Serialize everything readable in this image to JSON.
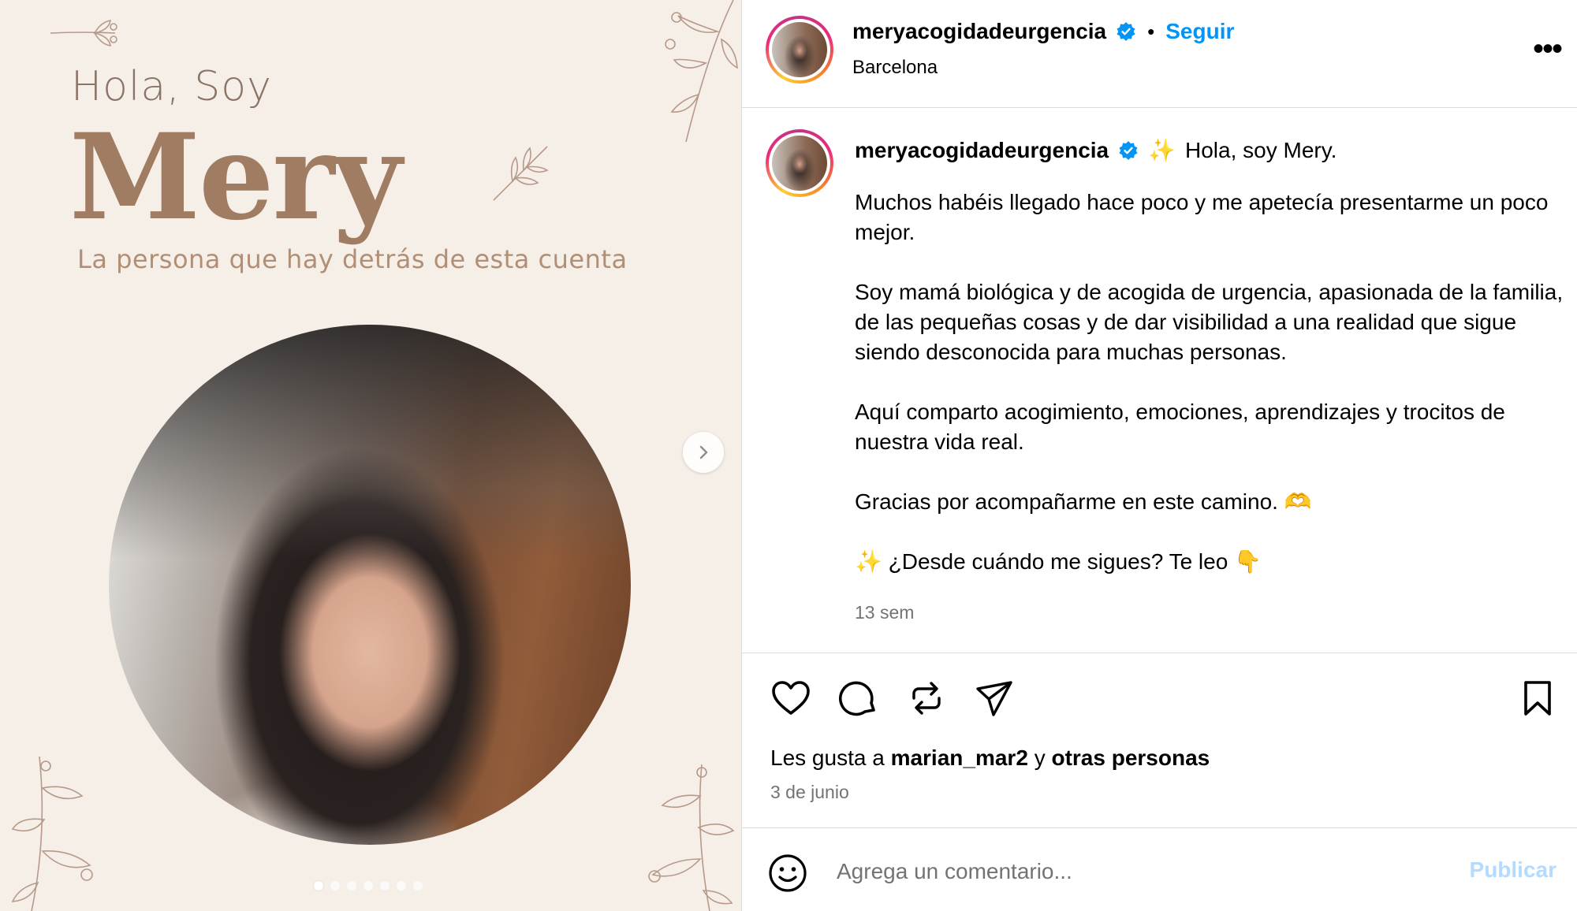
{
  "media": {
    "greeting": "Hola, Soy",
    "name": "Mery",
    "tagline": "La persona que hay detrás de esta cuenta",
    "next_icon": "chevron-right-icon",
    "slide_count": 7,
    "active_slide": 1
  },
  "header": {
    "username": "meryacogidadeurgencia",
    "separator": "•",
    "follow_label": "Seguir",
    "location": "Barcelona",
    "more_icon": "more-horizontal-icon",
    "more_label": "•••"
  },
  "caption": {
    "username": "meryacogidadeurgencia",
    "sparkle": "✨",
    "intro": "Hola, soy Mery.",
    "paragraphs": [
      "Muchos habéis llegado hace poco y me apetecía presentarme un poco mejor.",
      "Soy mamá biológica y de acogida de urgencia, apasionada de la familia, de las pequeñas cosas y de dar visibilidad a una realidad que sigue siendo desconocida para muchas personas.",
      "Aquí comparto acogimiento, emociones, aprendizajes y trocitos de nuestra vida real.",
      "Gracias por acompañarme en este camino. 🫶",
      "✨ ¿Desde cuándo me sigues? Te leo 👇"
    ],
    "time_ago": "13 sem"
  },
  "actions": {
    "like_icon": "heart-icon",
    "comment_icon": "comment-icon",
    "repost_icon": "repost-icon",
    "share_icon": "send-icon",
    "save_icon": "bookmark-icon"
  },
  "likes": {
    "prefix": "Les gusta a",
    "user": "marian_mar2",
    "connector": "y",
    "others": "otras personas"
  },
  "date": "3 de junio",
  "comment": {
    "emoji_icon": "smiley-icon",
    "placeholder": "Agrega un comentario...",
    "value": "",
    "publish_label": "Publicar"
  },
  "colors": {
    "accent": "#0095f6",
    "publish_disabled": "#b3dbff",
    "card_background": "#f6efe7",
    "title_brown": "#a07c63",
    "verified": "#0095f6"
  }
}
